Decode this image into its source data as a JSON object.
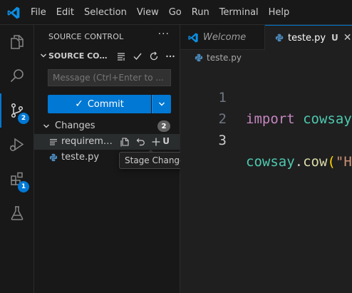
{
  "menu": [
    "File",
    "Edit",
    "Selection",
    "View",
    "Go",
    "Run",
    "Terminal",
    "Help"
  ],
  "activity": {
    "scm_badge": "2",
    "extensions_badge": "1"
  },
  "sidebar": {
    "header": "SOURCE CONTROL",
    "more": "···",
    "repo_title": "SOURCE CONTROL",
    "message_placeholder": "Message (Ctrl+Enter to ...",
    "commit_label": "Commit",
    "changes_label": "Changes",
    "changes_count": "2",
    "files": [
      {
        "name": "requirements.txt",
        "status": "U"
      },
      {
        "name": "teste.py"
      }
    ],
    "tooltip": "Stage Changes"
  },
  "tabs": [
    {
      "label": "Welcome"
    },
    {
      "label": "teste.py",
      "status": "U"
    }
  ],
  "breadcrumb": "teste.py",
  "editor": {
    "line_numbers": [
      "1",
      "2",
      "3"
    ],
    "line1": {
      "keyword": "import",
      "module": "cowsay"
    },
    "line3": {
      "object": "cowsay",
      "dot": ".",
      "func": "cow",
      "paren": "(",
      "string": "\"H"
    }
  },
  "colors": {
    "accent": "#0078d4",
    "python_icon": "#4b8bbe"
  }
}
